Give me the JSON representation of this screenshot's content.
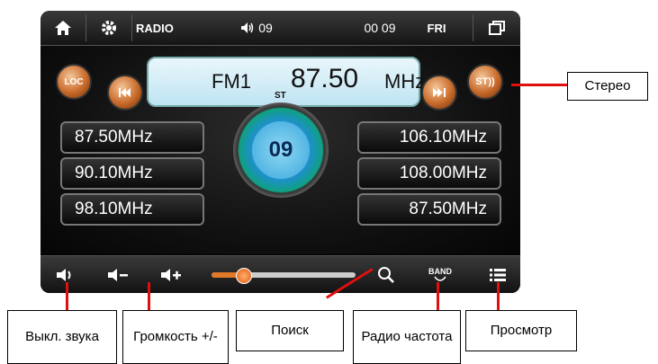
{
  "topbar": {
    "mode_label": "RADIO",
    "volume_label": "09",
    "clock": "00 09",
    "weekday": "FRI"
  },
  "display": {
    "band": "FM1",
    "frequency": "87.50",
    "unit": "MHz",
    "stereo_indicator": "ST"
  },
  "buttons": {
    "loc": "LOC",
    "st": "ST))"
  },
  "presets_left": [
    "87.50MHz",
    "90.10MHz",
    "98.10MHz"
  ],
  "presets_right": [
    "106.10MHz",
    "108.00MHz",
    "87.50MHz"
  ],
  "dial_value": "09",
  "volume_slider_level": 0.22,
  "bottombar": {
    "band_label": "BAND"
  },
  "callouts": {
    "stereo": "Стерео",
    "mute": "Выкл. звука",
    "volume": "Громкость +/-",
    "search": "Поиск",
    "band": "Радио частота",
    "browse": "Просмотр"
  },
  "colors": {
    "accent_orange": "#e07a2a",
    "arrow_red": "#e01010"
  },
  "icons": [
    "home-icon",
    "gear-icon",
    "speaker-icon",
    "windows-icon",
    "prev-icon",
    "next-icon",
    "mute-icon",
    "volume-down-icon",
    "volume-up-icon",
    "search-icon",
    "band-icon",
    "list-icon"
  ]
}
